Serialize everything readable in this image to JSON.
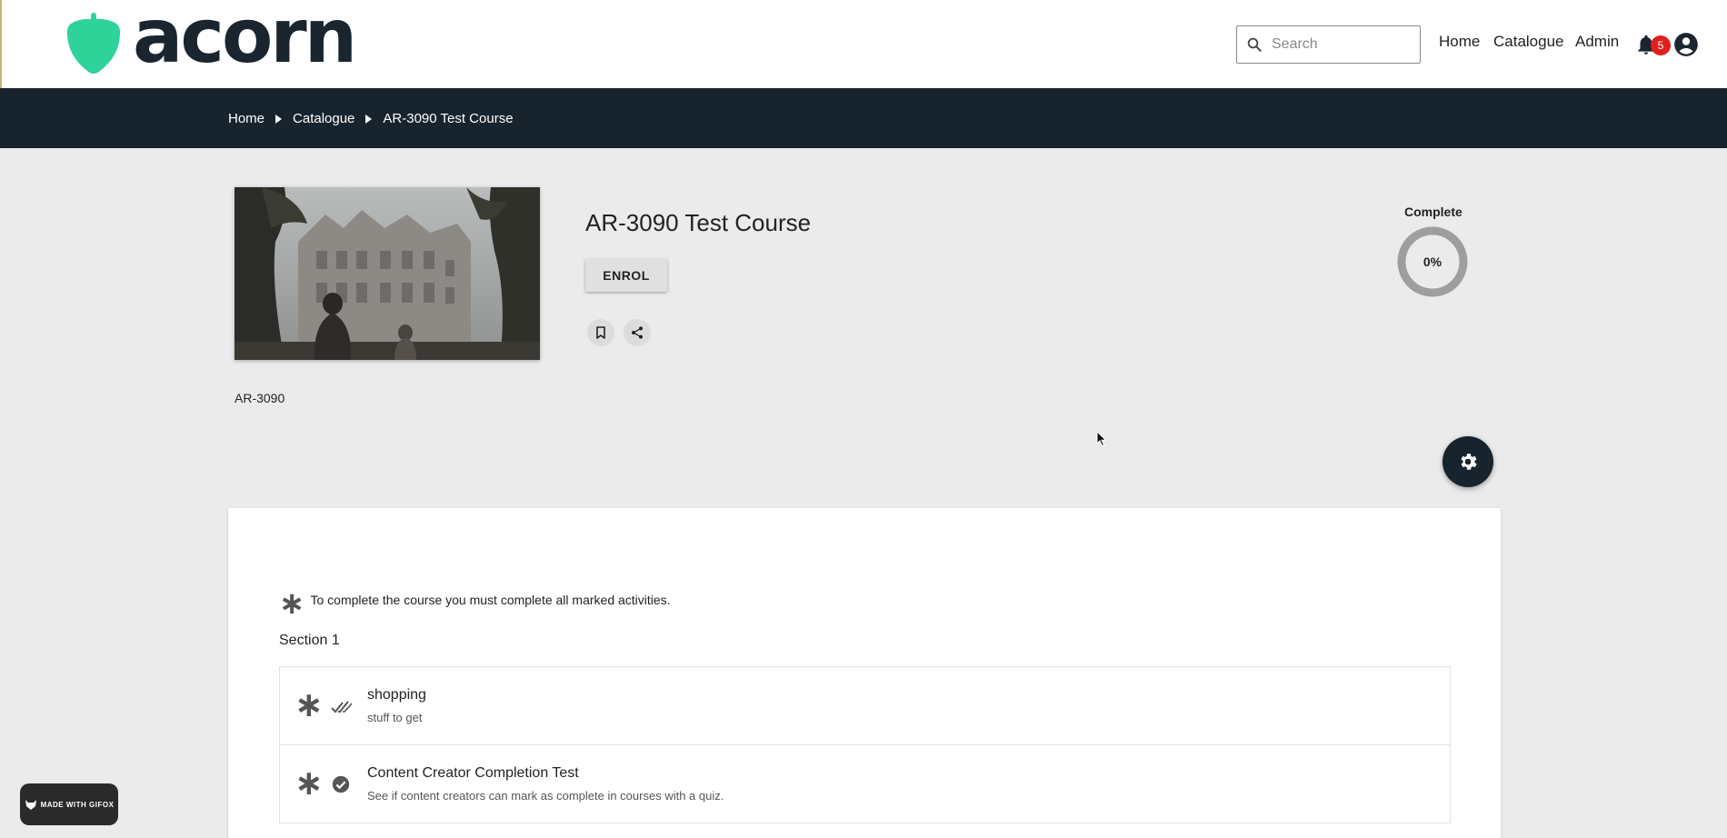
{
  "header": {
    "logo_text": "acorn",
    "search_placeholder": "Search",
    "nav": {
      "home": "Home",
      "catalogue": "Catalogue",
      "admin": "Admin"
    },
    "notification_count": "5"
  },
  "breadcrumb": [
    "Home",
    "Catalogue",
    "AR-3090 Test Course"
  ],
  "course": {
    "title": "AR-3090 Test Course",
    "enrol_label": "ENROL",
    "code": "AR-3090",
    "progress_label": "Complete",
    "progress_text": "0%",
    "progress_value": 0
  },
  "content": {
    "note": "To complete the course you must complete all marked activities.",
    "section_title": "Section 1",
    "activities": [
      {
        "title": "shopping",
        "description": "stuff to get",
        "status_icon": "double-check-icon"
      },
      {
        "title": "Content Creator Completion Test",
        "description": "See if content creators can mark as complete in courses with a quiz.",
        "status_icon": "check-circle-icon"
      }
    ]
  },
  "watermark": "MADE WITH GIFOX",
  "colors": {
    "brand_green": "#2ed39a",
    "dark_navy": "#17232d",
    "badge_red": "#e02020"
  }
}
